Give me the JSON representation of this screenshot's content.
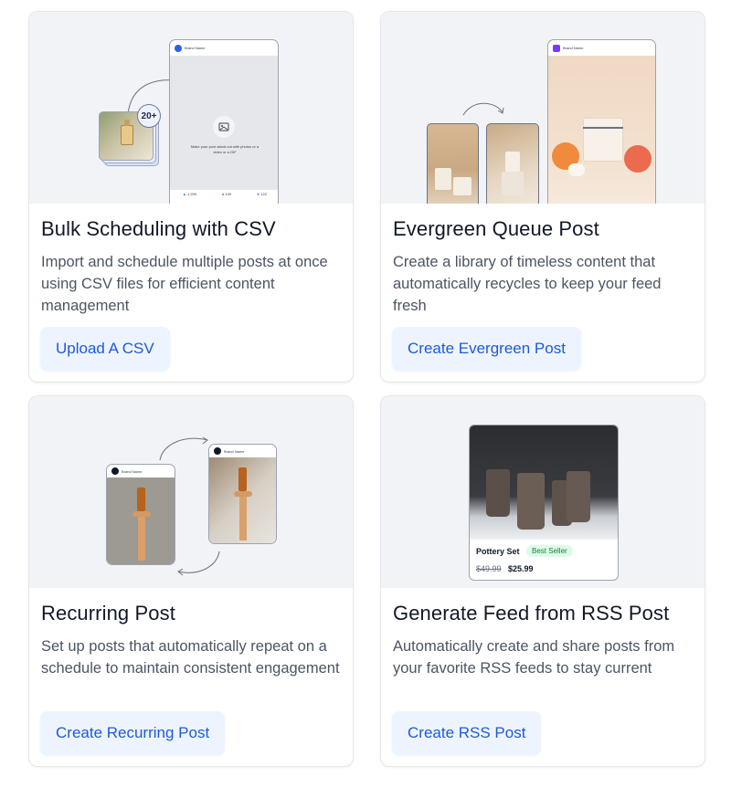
{
  "cards": [
    {
      "title": "Bulk Scheduling with CSV",
      "description": "Import and schedule multiple posts at once using CSV files for efficient content management",
      "button": "Upload A CSV",
      "preview": {
        "brand_name": "Brand Name",
        "count_badge": "20+",
        "upload_hint": "Make your post stand out with photos or a video or a GIF",
        "likes": "1,299",
        "comments": "199",
        "shares": "122"
      }
    },
    {
      "title": "Evergreen Queue Post",
      "description": "Create a library of timeless content that automatically recycles to keep your feed fresh",
      "button": "Create Evergreen Post",
      "preview": {
        "brand_name": "Brand Name"
      }
    },
    {
      "title": "Recurring Post",
      "description": "Set up posts that automatically repeat on a schedule to maintain consistent engagement",
      "button": "Create Recurring Post",
      "preview": {
        "brand_name": "Brand Name"
      }
    },
    {
      "title": "Generate Feed from RSS Post",
      "description": "Automatically create and share posts from your favorite RSS feeds to stay current",
      "button": "Create RSS Post",
      "preview": {
        "product_name": "Pottery Set",
        "badge": "Best Seller",
        "old_price": "$49.99",
        "price": "$25.99"
      }
    }
  ],
  "colors": {
    "accent": "#1d5ad8",
    "button_bg": "#eef4ff",
    "hero_bg": "#f2f3f6",
    "badge_green": "#15803d"
  }
}
